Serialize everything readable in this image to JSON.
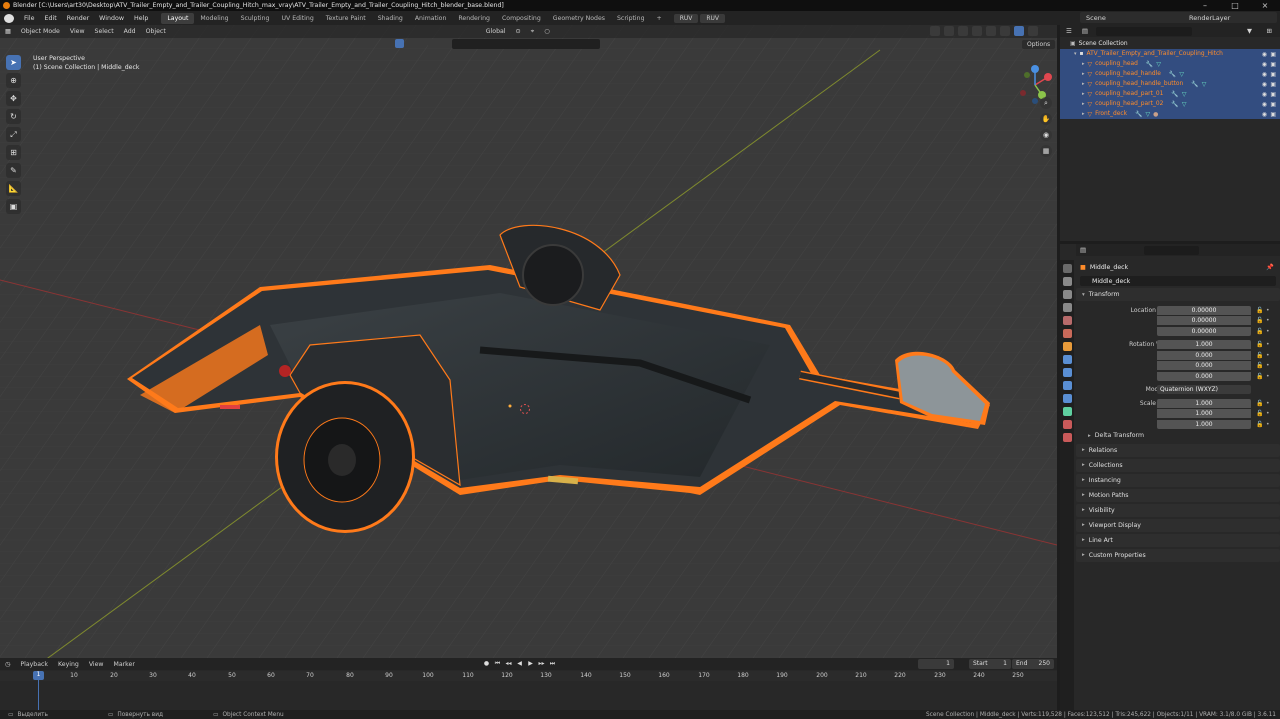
{
  "title_bar": {
    "text": "Blender [C:\\Users\\art30\\Desktop\\ATV_Trailer_Empty_and_Trailer_Coupling_Hitch_max_vray\\ATV_Trailer_Empty_and_Trailer_Coupling_Hitch_blender_base.blend]"
  },
  "menu": [
    "File",
    "Edit",
    "Render",
    "Window",
    "Help"
  ],
  "workspaces": [
    "Layout",
    "Modeling",
    "Sculpting",
    "UV Editing",
    "Texture Paint",
    "Shading",
    "Animation",
    "Rendering",
    "Compositing",
    "Geometry Nodes",
    "Scripting"
  ],
  "active_workspace": "Layout",
  "ruv_buttons": [
    "RUV",
    "RUV"
  ],
  "scene": "Scene",
  "view_layer": "RenderLayer",
  "viewport": {
    "mode": "Object Mode",
    "menu": [
      "View",
      "Select",
      "Add",
      "Object"
    ],
    "orientation": "Global",
    "options": "Options",
    "view_name": "User Perspective",
    "context": "(1) Scene Collection | Middle_deck"
  },
  "outliner": {
    "root": "Scene Collection",
    "collection": "ATV_Trailer_Empty_and_Trailer_Coupling_Hitch",
    "items": [
      "coupling_head",
      "coupling_head_handle",
      "coupling_head_handle_button",
      "coupling_head_part_01",
      "coupling_head_part_02",
      "Front_deck"
    ]
  },
  "properties": {
    "object_name": "Middle_deck",
    "data_name": "Middle_deck",
    "transform_label": "Transform",
    "location_label": "Location X",
    "location": [
      "0.00000",
      "0.00000",
      "0.00000"
    ],
    "rotation_label": "Rotation W",
    "rotation": [
      "1.000",
      "0.000",
      "0.000",
      "0.000"
    ],
    "mode_label": "Mode",
    "mode_value": "Quaternion (WXYZ)",
    "scale_label": "Scale X",
    "scale": [
      "1.000",
      "1.000",
      "1.000"
    ],
    "axis_y": "Y",
    "axis_z": "Z",
    "axis_x": "X",
    "delta_transform": "Delta Transform",
    "panels": [
      "Relations",
      "Collections",
      "Instancing",
      "Motion Paths",
      "Visibility",
      "Viewport Display",
      "Line Art",
      "Custom Properties"
    ]
  },
  "timeline": {
    "menu": [
      "Playback",
      "Keying",
      "View",
      "Marker"
    ],
    "current_frame": "1",
    "start_label": "Start",
    "start": "1",
    "end_label": "End",
    "end": "250",
    "ticks": [
      "10",
      "20",
      "30",
      "40",
      "50",
      "60",
      "70",
      "80",
      "90",
      "100",
      "110",
      "120",
      "130",
      "140",
      "150",
      "160",
      "170",
      "180",
      "190",
      "200",
      "210",
      "220",
      "230",
      "240",
      "250"
    ],
    "ruler_current": "1"
  },
  "statusbar": {
    "left1": "Выделить",
    "left2": "Повернуть вид",
    "left3": "Object Context Menu",
    "right": "Scene Collection | Middle_deck | Verts:119,528 | Faces:123,512 | Tris:245,622 | Objects:1/11 | VRAM: 3.1/8.0 GiB | 3.6.11"
  },
  "colors": {
    "accent": "#4772b3",
    "selection": "#ff7a1a",
    "outliner_sel": "#334d80"
  }
}
